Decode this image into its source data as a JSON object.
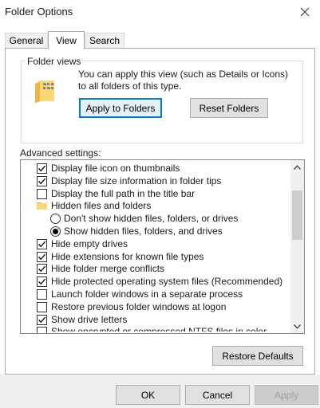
{
  "window": {
    "title": "Folder Options"
  },
  "tabs": [
    {
      "label": "General",
      "active": false
    },
    {
      "label": "View",
      "active": true
    },
    {
      "label": "Search",
      "active": false
    }
  ],
  "folder_views": {
    "group_label": "Folder views",
    "description": "You can apply this view (such as Details or Icons) to all folders of this type.",
    "apply_label": "Apply to Folders",
    "reset_label": "Reset Folders"
  },
  "advanced": {
    "label": "Advanced settings:",
    "items": [
      {
        "type": "checkbox",
        "checked": true,
        "level": 0,
        "label": "Display file icon on thumbnails"
      },
      {
        "type": "checkbox",
        "checked": true,
        "level": 0,
        "label": "Display file size information in folder tips"
      },
      {
        "type": "checkbox",
        "checked": false,
        "level": 0,
        "label": "Display the full path in the title bar"
      },
      {
        "type": "folder",
        "level": 0,
        "label": "Hidden files and folders"
      },
      {
        "type": "radio",
        "checked": false,
        "level": 1,
        "label": "Don't show hidden files, folders, or drives"
      },
      {
        "type": "radio",
        "checked": true,
        "level": 1,
        "label": "Show hidden files, folders, and drives"
      },
      {
        "type": "checkbox",
        "checked": true,
        "level": 0,
        "label": "Hide empty drives"
      },
      {
        "type": "checkbox",
        "checked": true,
        "level": 0,
        "label": "Hide extensions for known file types"
      },
      {
        "type": "checkbox",
        "checked": true,
        "level": 0,
        "label": "Hide folder merge conflicts"
      },
      {
        "type": "checkbox",
        "checked": true,
        "level": 0,
        "label": "Hide protected operating system files (Recommended)"
      },
      {
        "type": "checkbox",
        "checked": false,
        "level": 0,
        "label": "Launch folder windows in a separate process"
      },
      {
        "type": "checkbox",
        "checked": false,
        "level": 0,
        "label": "Restore previous folder windows at logon"
      },
      {
        "type": "checkbox",
        "checked": true,
        "level": 0,
        "label": "Show drive letters"
      },
      {
        "type": "checkbox",
        "checked": false,
        "level": 0,
        "label": "Show encrypted or compressed NTFS files in color"
      }
    ],
    "restore_defaults_label": "Restore Defaults"
  },
  "footer": {
    "ok_label": "OK",
    "cancel_label": "Cancel",
    "apply_label": "Apply"
  },
  "colors": {
    "accent": "#0078d7",
    "button_face": "#e1e1e1",
    "footer_bg": "#f0f0f0",
    "folder_yellow": "#f8d775"
  }
}
